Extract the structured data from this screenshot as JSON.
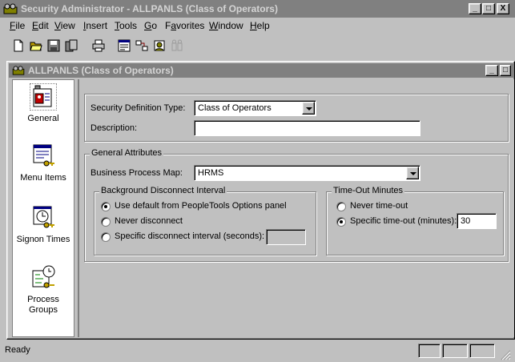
{
  "app": {
    "title": "Security Administrator - ALLPANLS (Class of Operators)",
    "caption_buttons": [
      "_",
      "□",
      "X"
    ]
  },
  "menu": [
    "File",
    "Edit",
    "View",
    "Insert",
    "Tools",
    "Go",
    "Favorites",
    "Window",
    "Help"
  ],
  "menu_underline": [
    "F",
    "E",
    "V",
    "I",
    "T",
    "G",
    "a",
    "W",
    "H"
  ],
  "toolbar": {
    "buttons": [
      "new-icon",
      "open-icon",
      "save-icon",
      "copy-icon",
      "print-icon",
      "panel-icon",
      "workflow-icon",
      "people-icon"
    ]
  },
  "child_window": {
    "title": "ALLPANLS (Class of Operators)",
    "caption_buttons": [
      "_",
      "□"
    ]
  },
  "nav": {
    "items": [
      {
        "label": "General",
        "icon": "badge-icon",
        "selected": true
      },
      {
        "label": "Menu Items",
        "icon": "menu-key-icon",
        "selected": false
      },
      {
        "label": "Signon Times",
        "icon": "clock-key-icon",
        "selected": false
      },
      {
        "label": "Process Groups",
        "icon": "process-clock-icon",
        "selected": false
      }
    ]
  },
  "form": {
    "security_definition_type": {
      "label": "Security Definition Type:",
      "value": "Class of Operators"
    },
    "description": {
      "label": "Description:",
      "value": ""
    },
    "general_attributes": {
      "title": "General Attributes",
      "business_process_map": {
        "label": "Business Process Map:",
        "value": "HRMS"
      },
      "background_disconnect": {
        "title": "Background Disconnect Interval",
        "options": [
          "Use default from PeopleTools Options panel",
          "Never disconnect",
          "Specific disconnect interval (seconds):"
        ],
        "selected": 0,
        "seconds_value": ""
      },
      "timeout": {
        "title": "Time-Out Minutes",
        "options": [
          "Never time-out",
          "Specific time-out (minutes):"
        ],
        "selected": 1,
        "minutes_value": "30"
      }
    }
  },
  "status": {
    "text": "Ready"
  }
}
